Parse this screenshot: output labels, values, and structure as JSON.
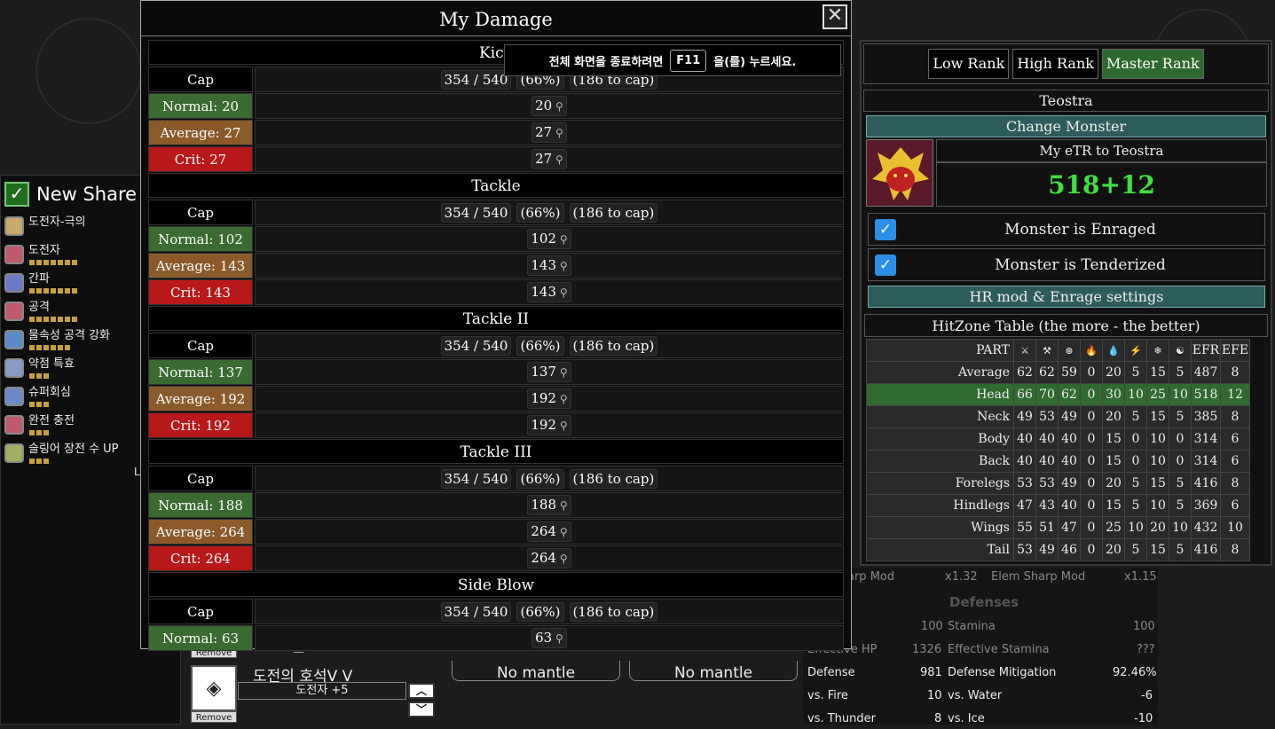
{
  "dialog": {
    "title": "My Damage",
    "close_icon": "close-icon",
    "sections": [
      {
        "name": "Kick",
        "rows": [
          {
            "label": "Cap",
            "kind": "cap",
            "value": "354 / 540",
            "pct": "(66%)",
            "note": "(186 to cap)"
          },
          {
            "label": "Normal: 20",
            "kind": "normal",
            "value": "20"
          },
          {
            "label": "Average: 27",
            "kind": "avg",
            "value": "27"
          },
          {
            "label": "Crit: 27",
            "kind": "crit",
            "value": "27"
          }
        ]
      },
      {
        "name": "Tackle",
        "rows": [
          {
            "label": "Cap",
            "kind": "cap",
            "value": "354 / 540",
            "pct": "(66%)",
            "note": "(186 to cap)"
          },
          {
            "label": "Normal: 102",
            "kind": "normal",
            "value": "102"
          },
          {
            "label": "Average: 143",
            "kind": "avg",
            "value": "143"
          },
          {
            "label": "Crit: 143",
            "kind": "crit",
            "value": "143"
          }
        ]
      },
      {
        "name": "Tackle II",
        "rows": [
          {
            "label": "Cap",
            "kind": "cap",
            "value": "354 / 540",
            "pct": "(66%)",
            "note": "(186 to cap)"
          },
          {
            "label": "Normal: 137",
            "kind": "normal",
            "value": "137"
          },
          {
            "label": "Average: 192",
            "kind": "avg",
            "value": "192"
          },
          {
            "label": "Crit: 192",
            "kind": "crit",
            "value": "192"
          }
        ]
      },
      {
        "name": "Tackle III",
        "rows": [
          {
            "label": "Cap",
            "kind": "cap",
            "value": "354 / 540",
            "pct": "(66%)",
            "note": "(186 to cap)"
          },
          {
            "label": "Normal: 188",
            "kind": "normal",
            "value": "188"
          },
          {
            "label": "Average: 264",
            "kind": "avg",
            "value": "264"
          },
          {
            "label": "Crit: 264",
            "kind": "crit",
            "value": "264"
          }
        ]
      },
      {
        "name": "Side Blow",
        "rows": [
          {
            "label": "Cap",
            "kind": "cap",
            "value": "354 / 540",
            "pct": "(66%)",
            "note": "(186 to cap)"
          },
          {
            "label": "Normal: 63",
            "kind": "normal",
            "value": "63"
          }
        ]
      }
    ]
  },
  "toast": {
    "before": "전체 화면을 종료하려면",
    "key": "F11",
    "after": "을(를) 누르세요."
  },
  "left_panel": {
    "title": "New Share",
    "skills": [
      {
        "name": "도전자-극의",
        "pips": 0,
        "color": "#c9a86a"
      },
      {
        "name": "도전자",
        "pips": 7,
        "color": "#c05a6a"
      },
      {
        "name": "간파",
        "pips": 7,
        "color": "#6a7ac9"
      },
      {
        "name": "공격",
        "pips": 7,
        "color": "#c05a6a"
      },
      {
        "name": "물속성 공격 강화",
        "pips": 6,
        "color": "#5a8ac9"
      },
      {
        "name": "약점 특효",
        "pips": 3,
        "color": "#8a9ac9"
      },
      {
        "name": "슈퍼회심",
        "pips": 3,
        "color": "#6a8ac9"
      },
      {
        "name": "완전 충전",
        "pips": 3,
        "color": "#c05a6a"
      },
      {
        "name": "슬링어 장전 수 UP",
        "pips": 3,
        "color": "#a0b060"
      }
    ],
    "lv_text": "L"
  },
  "bottom": {
    "remove": "Remove",
    "deco_name": "도전의 호석V V",
    "deco_skill": "도전자 +5",
    "mantle1": "No mantle",
    "mantle2": "No mantle",
    "up_icon": "chevron-up-icon",
    "down_icon": "chevron-down-icon"
  },
  "stats": {
    "sharp_mod": "arp Mod",
    "sharp_val": "x1.32",
    "elem_sharp": "Elem Sharp Mod",
    "elem_sharp_val": "x1.15",
    "defenses": "Defenses",
    "health_val": "100",
    "stamina": "Stamina",
    "stamina_val": "100",
    "eff_hp": "Effective HP",
    "eff_hp_val": "1326",
    "eff_stamina": "Effective Stamina",
    "eff_stamina_val": "???",
    "defense": "Defense",
    "defense_val": "981",
    "def_mit": "Defense Mitigation",
    "def_mit_val": "92.46%",
    "fire": "vs. Fire",
    "fire_val": "10",
    "water": "vs. Water",
    "water_val": "-6",
    "thunder": "vs. Thunder",
    "thunder_val": "8",
    "ice": "vs. Ice",
    "ice_val": "-10"
  },
  "right_panel": {
    "ranks": [
      "Low Rank",
      "High Rank",
      "Master Rank"
    ],
    "active_rank": "Master Rank",
    "monster": "Teostra",
    "change_monster": "Change Monster",
    "etr_label": "My eTR to Teostra",
    "etr_value": "518+12",
    "enraged": "Monster is Enraged",
    "tenderized": "Monster is Tenderized",
    "hr_mod": "HR mod & Enrage settings",
    "hitzone_title": "HitZone Table (the more - the better)",
    "hitzone_header": {
      "part": "PART",
      "icons": [
        "sever-icon",
        "blunt-icon",
        "shot-icon",
        "fire-icon",
        "water-icon",
        "thunder-icon",
        "ice-icon",
        "dragon-icon"
      ],
      "glyphs": [
        "⚔",
        "⚒",
        "⊛",
        "🔥",
        "💧",
        "⚡",
        "❄",
        "☯"
      ],
      "efr": "EFR",
      "efe": "EFE"
    },
    "hitzones": [
      {
        "part": "Average",
        "v": [
          "62",
          "62",
          "59",
          "0",
          "20",
          "5",
          "15",
          "5",
          "487",
          "8"
        ]
      },
      {
        "part": "Head",
        "v": [
          "66",
          "70",
          "62",
          "0",
          "30",
          "10",
          "25",
          "10",
          "518",
          "12"
        ],
        "highlight": true
      },
      {
        "part": "Neck",
        "v": [
          "49",
          "53",
          "49",
          "0",
          "20",
          "5",
          "15",
          "5",
          "385",
          "8"
        ]
      },
      {
        "part": "Body",
        "v": [
          "40",
          "40",
          "40",
          "0",
          "15",
          "0",
          "10",
          "0",
          "314",
          "6"
        ]
      },
      {
        "part": "Back",
        "v": [
          "40",
          "40",
          "40",
          "0",
          "15",
          "0",
          "10",
          "0",
          "314",
          "6"
        ]
      },
      {
        "part": "Forelegs",
        "v": [
          "53",
          "53",
          "49",
          "0",
          "20",
          "5",
          "15",
          "5",
          "416",
          "8"
        ]
      },
      {
        "part": "Hindlegs",
        "v": [
          "47",
          "43",
          "40",
          "0",
          "15",
          "5",
          "10",
          "5",
          "369",
          "6"
        ]
      },
      {
        "part": "Wings",
        "v": [
          "55",
          "51",
          "47",
          "0",
          "25",
          "10",
          "20",
          "10",
          "432",
          "10"
        ]
      },
      {
        "part": "Tail",
        "v": [
          "53",
          "49",
          "46",
          "0",
          "20",
          "5",
          "15",
          "5",
          "416",
          "8"
        ]
      }
    ]
  }
}
